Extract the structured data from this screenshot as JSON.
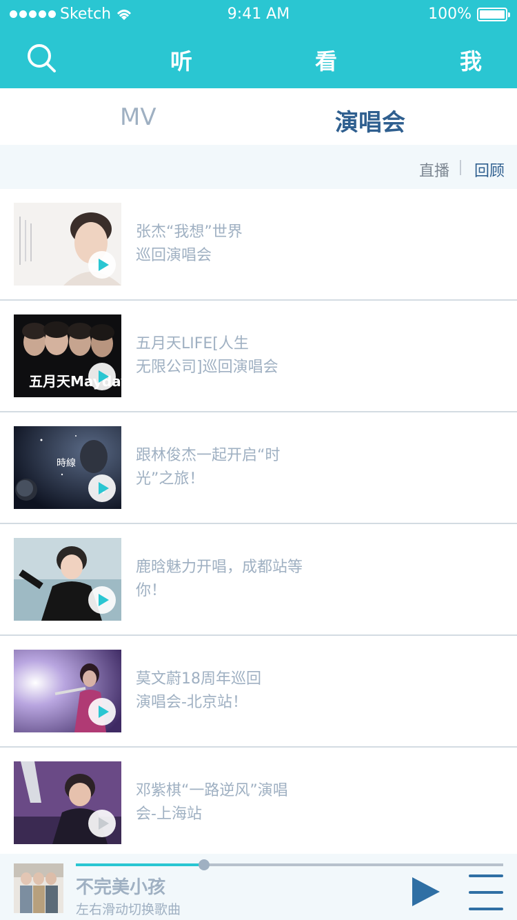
{
  "status_bar": {
    "carrier": "Sketch",
    "time": "9:41 AM",
    "battery": "100%",
    "battery_level": 1.0
  },
  "nav": {
    "items": [
      {
        "label": "听"
      },
      {
        "label": "看"
      },
      {
        "label": "我"
      }
    ]
  },
  "tabs": [
    {
      "label": "MV"
    },
    {
      "label": "演唱会"
    }
  ],
  "filter": {
    "live": "直播",
    "replay": "回顾"
  },
  "concerts": [
    {
      "title": "张杰“我想”世界\n巡回演唱会"
    },
    {
      "title": "五月天LIFE[人生\n无限公司]巡回演唱会",
      "thumb_text": "五月天Mayday"
    },
    {
      "title": "跟林俊杰一起开启“时\n光”之旅！",
      "thumb_text": "時線"
    },
    {
      "title": "鹿晗魅力开唱，成都站等\n你！"
    },
    {
      "title": "莫文蔚18周年巡回\n演唱会-北京站！"
    },
    {
      "title": "邓紫棋“一路逆风”演唱\n会-上海站"
    }
  ],
  "player": {
    "song": "不完美小孩",
    "hint": "左右滑动切换歌曲",
    "progress": 0.3
  },
  "colors": {
    "primary": "#2ac6d2",
    "active_text": "#2f5f8f",
    "muted_text": "#9fb0c2"
  }
}
